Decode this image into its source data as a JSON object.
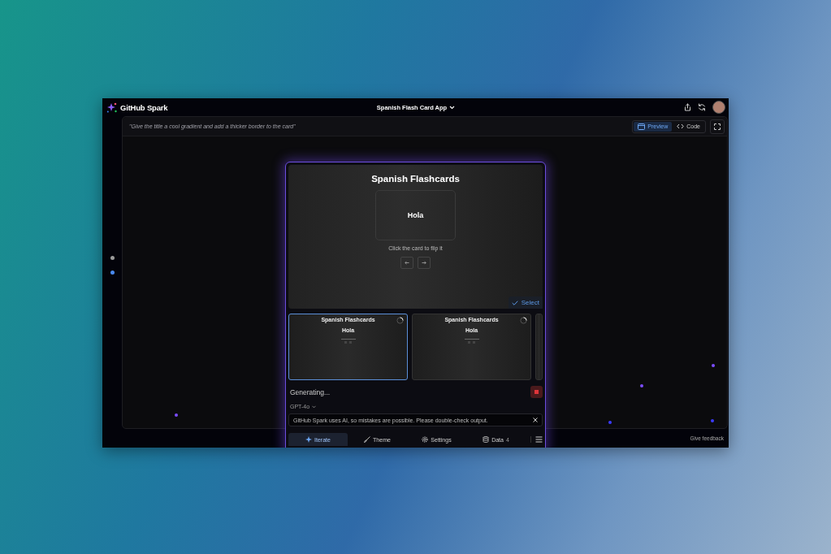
{
  "app": {
    "name": "GitHub Spark",
    "project_title": "Spanish Flash Card App"
  },
  "prompt_bar": {
    "prompt": "\"Give the title a cool gradient and add a thicker border to the card\"",
    "view_toggle": [
      {
        "label": "Preview",
        "selected": true
      },
      {
        "label": "Code",
        "selected": false
      }
    ]
  },
  "page_dots": [
    {
      "selected": false
    },
    {
      "selected": true
    }
  ],
  "preview": {
    "title": "Spanish Flashcards",
    "card_text": "Hola",
    "hint": "Click the card to flip it",
    "select_button": "Select"
  },
  "variants": [
    {
      "title": "Spanish Flashcards",
      "card_text": "Hola",
      "selected": true
    },
    {
      "title": "Spanish Flashcards",
      "card_text": "Hola",
      "selected": false
    },
    {
      "selected": false
    }
  ],
  "status": "Generating...",
  "model": "GPT-4o",
  "notice": "GitHub Spark uses AI, so mistakes are possible. Please double-check output.",
  "tabs": [
    {
      "label": "Iterate",
      "selected": true
    },
    {
      "label": "Theme",
      "selected": false
    },
    {
      "label": "Settings",
      "selected": false
    },
    {
      "label": "Data",
      "count": "4",
      "selected": false
    }
  ],
  "footer": {
    "feedback": "Give feedback"
  }
}
